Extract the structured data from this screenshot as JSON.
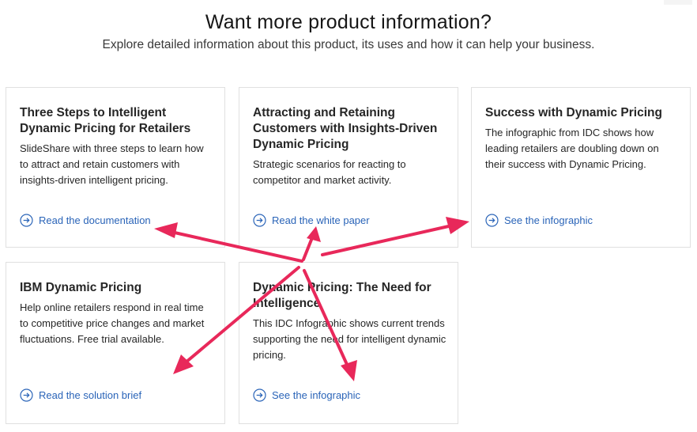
{
  "header": {
    "title": "Want more product information?",
    "subtitle": "Explore detailed information about this product, its uses and how it can help your business."
  },
  "cards": [
    {
      "title": "Three Steps to Intelligent Dynamic Pricing for Retailers",
      "description": "SlideShare with three steps to learn how to attract and retain customers with insights-driven intelligent pricing.",
      "link_label": "Read the documentation",
      "link_icon": "arrow-right-circle-icon"
    },
    {
      "title": "Attracting and Retaining Customers with Insights-Driven Dynamic Pricing",
      "description": "Strategic scenarios for reacting to competitor and market activity.",
      "link_label": "Read the white paper",
      "link_icon": "arrow-right-circle-icon"
    },
    {
      "title": "Success with Dynamic Pricing",
      "description": "The infographic from IDC shows how leading retailers are doubling down on their success with Dynamic Pricing.",
      "link_label": "See the infographic",
      "link_icon": "arrow-right-circle-icon"
    },
    {
      "title": "IBM Dynamic Pricing",
      "description": "Help online retailers respond in real time to competitive price changes and market fluctuations. Free trial available.",
      "link_label": "Read the solution brief",
      "link_icon": "arrow-right-circle-icon"
    },
    {
      "title": "Dynamic Pricing: The Need for Intelligence",
      "description": "This IDC Infographic shows current trends supporting the need for intelligent dynamic pricing.",
      "link_label": "See the infographic",
      "link_icon": "arrow-right-circle-icon"
    }
  ],
  "colors": {
    "link": "#2a64b8",
    "annotation_arrow": "#e8285a",
    "card_border": "#e0e0e0"
  }
}
